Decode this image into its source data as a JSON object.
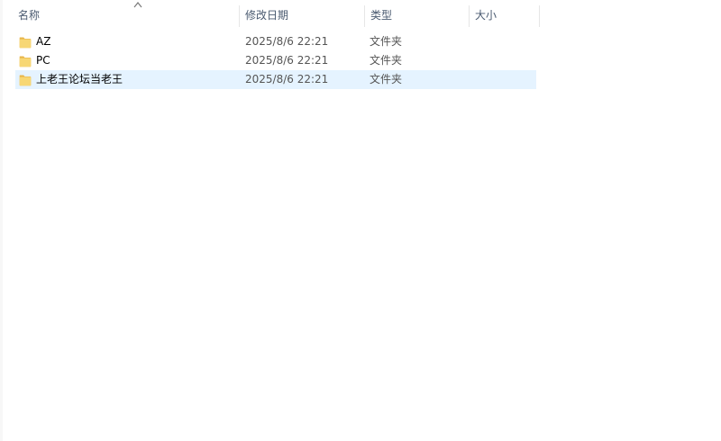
{
  "columns": {
    "name": "名称",
    "date_modified": "修改日期",
    "type": "类型",
    "size": "大小",
    "sorted_by": "name",
    "sort_direction": "ascending"
  },
  "files": [
    {
      "name": "AZ",
      "date_modified": "2025/8/6 22:21",
      "type": "文件夹",
      "size": "",
      "icon": "folder-icon",
      "selected": false
    },
    {
      "name": "PC",
      "date_modified": "2025/8/6 22:21",
      "type": "文件夹",
      "size": "",
      "icon": "folder-icon",
      "selected": false
    },
    {
      "name": "上老王论坛当老王",
      "date_modified": "2025/8/6 22:21",
      "type": "文件夹",
      "size": "",
      "icon": "folder-icon",
      "selected": true
    }
  ],
  "colors": {
    "selection": "#e5f3ff",
    "folder": "#f7d774",
    "header_text": "#4a5a70"
  }
}
